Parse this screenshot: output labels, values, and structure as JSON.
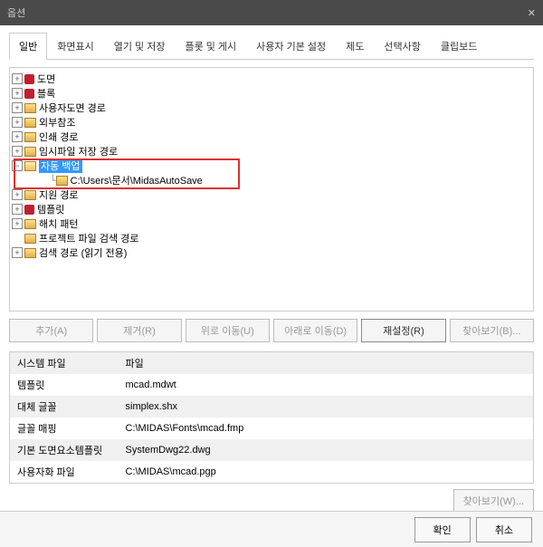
{
  "title": "옵션",
  "tabs": [
    "일반",
    "화면표시",
    "열기 및 저장",
    "플롯 및 게시",
    "사용자 기본 설정",
    "제도",
    "선택사항",
    "클립보드"
  ],
  "active_tab": 0,
  "tree": [
    {
      "exp": "+",
      "icon": "red",
      "label": "도면",
      "indent": 0
    },
    {
      "exp": "+",
      "icon": "red",
      "label": "블록",
      "indent": 0
    },
    {
      "exp": "+",
      "icon": "folder",
      "label": "사용자도면 경로",
      "indent": 0
    },
    {
      "exp": "+",
      "icon": "folder",
      "label": "외부참조",
      "indent": 0
    },
    {
      "exp": "+",
      "icon": "folder",
      "label": "인쇄 경로",
      "indent": 0
    },
    {
      "exp": "+",
      "icon": "folder",
      "label": "임시파일 저장 경로",
      "indent": 0
    },
    {
      "exp": "-",
      "icon": "folder-open",
      "label": "자동 백업",
      "indent": 0,
      "selected": true
    },
    {
      "exp": "",
      "icon": "folder",
      "label": "C:\\Users\\문서\\MidasAutoSave",
      "indent": 1
    },
    {
      "exp": "+",
      "icon": "folder",
      "label": "지원 경로",
      "indent": 0
    },
    {
      "exp": "+",
      "icon": "red",
      "label": "템플릿",
      "indent": 0
    },
    {
      "exp": "+",
      "icon": "folder",
      "label": "해치 패턴",
      "indent": 0
    },
    {
      "exp": "",
      "icon": "folder",
      "label": "프로젝트 파일 검색 경로",
      "indent": 0
    },
    {
      "exp": "+",
      "icon": "folder",
      "label": "검색 경로 (읽기 전용)",
      "indent": 0
    }
  ],
  "buttons": {
    "add": "추가(A)",
    "remove": "제거(R)",
    "moveup": "위로 이동(U)",
    "movedown": "아래로 이동(D)",
    "reset": "재설정(R)",
    "browse": "찾아보기(B)..."
  },
  "table": {
    "headers": [
      "시스템 파일",
      "파일"
    ],
    "rows": [
      [
        "템플릿",
        "mcad.mdwt"
      ],
      [
        "대체 글꼴",
        "simplex.shx"
      ],
      [
        "글꼴 매핑",
        "C:\\MIDAS\\Fonts\\mcad.fmp"
      ],
      [
        "기본 도면요소템플릿",
        "SystemDwg22.dwg"
      ],
      [
        "사용자화 파일",
        "C:\\MIDAS\\mcad.pgp"
      ]
    ]
  },
  "browse2": "찾아보기(W)...",
  "footer": {
    "ok": "확인",
    "cancel": "취소"
  }
}
